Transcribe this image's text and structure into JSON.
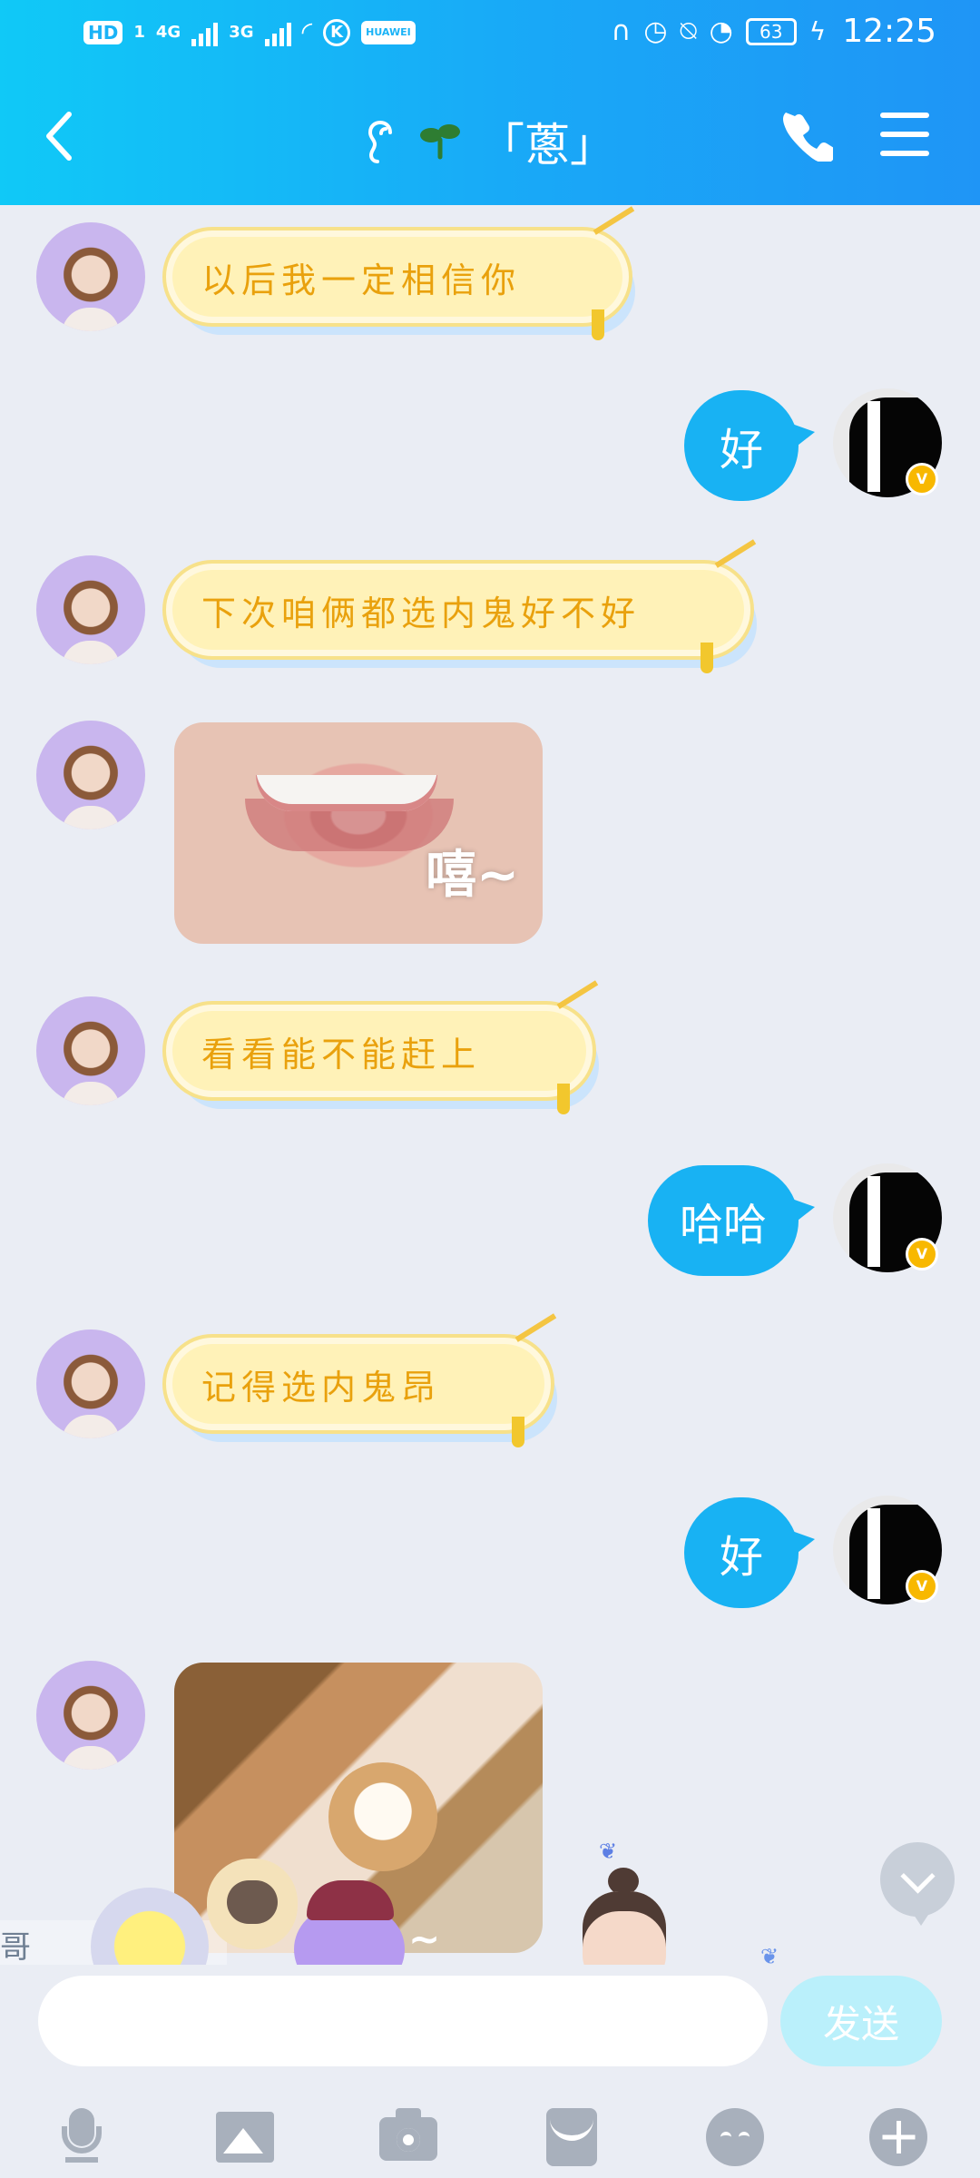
{
  "status_bar": {
    "left_items": [
      "HD",
      "1",
      "4G",
      "3G",
      "K",
      "HUAWEI"
    ],
    "battery": "63",
    "time": "12:25"
  },
  "header": {
    "title": "「蔥」",
    "icons": [
      "back-icon",
      "ear-icon",
      "sprout-icon",
      "phone-icon",
      "menu-icon"
    ]
  },
  "messages": [
    {
      "side": "left",
      "type": "bubble",
      "text": "以后我一定相信你"
    },
    {
      "side": "right",
      "type": "bubble",
      "text": "好"
    },
    {
      "side": "left",
      "type": "bubble",
      "text": "下次咱俩都选内鬼好不好"
    },
    {
      "side": "left",
      "type": "image",
      "caption": "嘻~"
    },
    {
      "side": "left",
      "type": "bubble",
      "text": "看看能不能赶上"
    },
    {
      "side": "right",
      "type": "bubble",
      "text": "哈哈"
    },
    {
      "side": "left",
      "type": "bubble",
      "text": "记得选内鬼昂"
    },
    {
      "side": "right",
      "type": "bubble",
      "text": "好"
    },
    {
      "side": "left",
      "type": "image",
      "caption": ""
    }
  ],
  "sticker_overlay": {
    "side_text": "哥",
    "tilde": "~"
  },
  "composer": {
    "placeholder": "",
    "send_label": "发送"
  },
  "toolbar": {
    "icons": [
      "microphone-icon",
      "image-icon",
      "camera-icon",
      "red-packet-icon",
      "emoji-icon",
      "plus-icon"
    ]
  },
  "colors": {
    "header_start": "#10c9f7",
    "header_end": "#1f95f6",
    "outgoing_bubble": "#18b2f3",
    "incoming_gold_text": "#e9a10d",
    "send_button": "#baf0fb"
  }
}
